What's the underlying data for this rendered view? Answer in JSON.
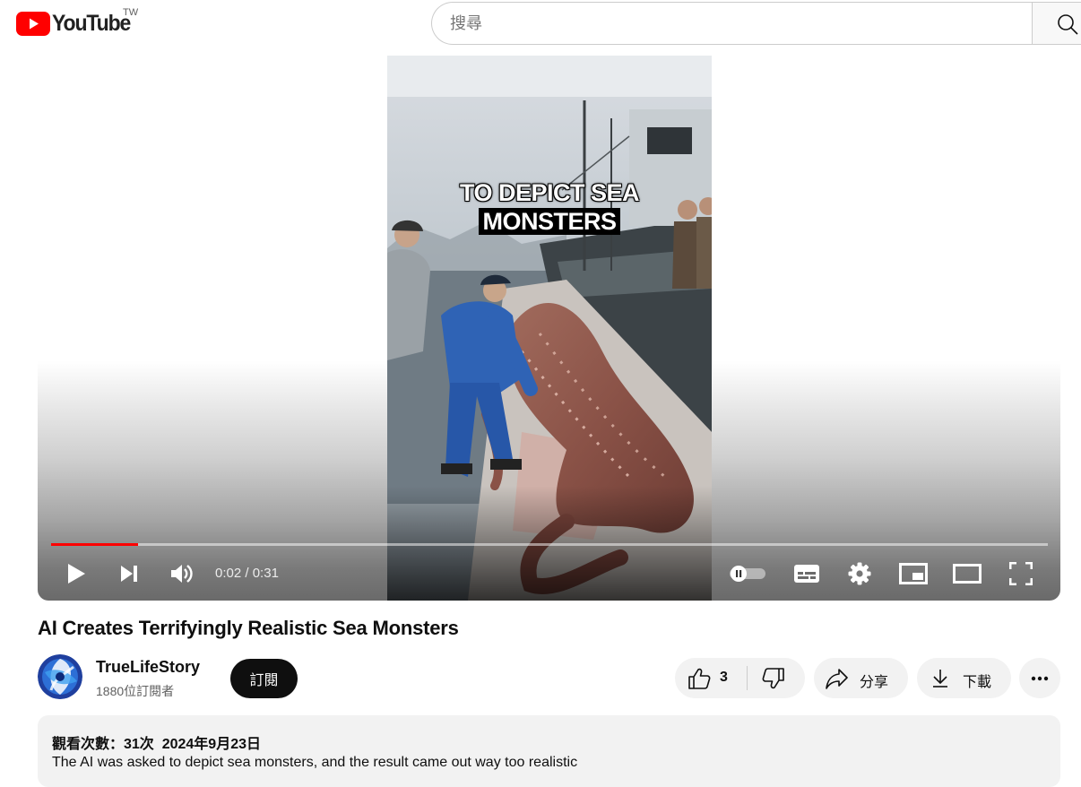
{
  "header": {
    "logo_text": "YouTube",
    "region_code": "TW",
    "search_placeholder": "搜尋"
  },
  "player": {
    "caption_line1": "TO DEPICT SEA",
    "caption_line2": "MONSTERS",
    "current_time": "0:02",
    "time_separator": " / ",
    "duration": "0:31",
    "progress_fraction": 0.087,
    "progress_color": "#ff0000",
    "autoplay_on": false
  },
  "video": {
    "title": "AI Creates Terrifyingly Realistic Sea Monsters"
  },
  "channel": {
    "name": "TrueLifeStory",
    "subscribers": "1880位訂閱者",
    "subscribe_label": "訂閱"
  },
  "actions": {
    "like_count": "3",
    "share_label": "分享",
    "download_label": "下載"
  },
  "description": {
    "views": "觀看次數：31次",
    "date": "2024年9月23日",
    "text": "The AI was asked to depict sea monsters, and the result came out way too realistic"
  }
}
